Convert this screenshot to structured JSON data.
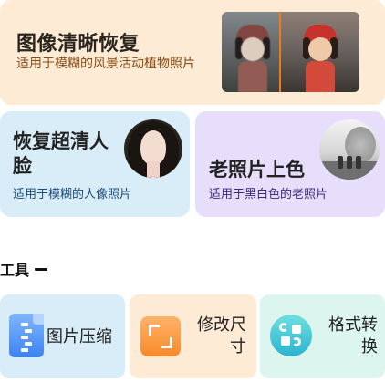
{
  "hero": {
    "title": "图像清晰恢复",
    "subtitle": "适用于模糊的风景活动植物照片"
  },
  "portrait": {
    "title": "恢复超清人脸",
    "subtitle": "适用于模糊的人像照片"
  },
  "colorize": {
    "title": "老照片上色",
    "subtitle": "适用于黑白色的老照片"
  },
  "tools": {
    "title": "工具",
    "items": [
      {
        "label": "图片压缩",
        "icon": "zip-file-icon"
      },
      {
        "label": "修改尺寸",
        "icon": "resize-icon"
      },
      {
        "label": "格式转换",
        "icon": "format-convert-icon"
      }
    ]
  },
  "colors": {
    "hero_bg": "#fdebd6",
    "portrait_bg": "#d9edf9",
    "colorize_bg": "#e6defb",
    "format_bg": "#dcf5ee",
    "accent_orange": "#f07a1a"
  }
}
